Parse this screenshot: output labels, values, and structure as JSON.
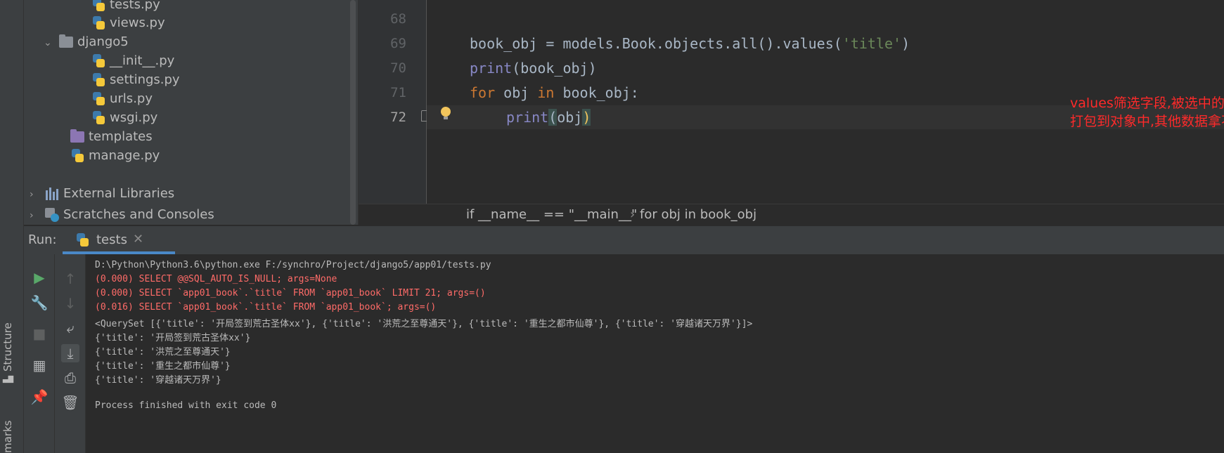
{
  "left_strip": {
    "structure": "Structure",
    "bookmarks": "marks"
  },
  "project_tree": {
    "items": [
      {
        "label": "tests.py",
        "type": "py"
      },
      {
        "label": "views.py",
        "type": "py"
      },
      {
        "label": "django5",
        "type": "folder",
        "expanded": true
      },
      {
        "label": "__init__.py",
        "type": "py"
      },
      {
        "label": "settings.py",
        "type": "py"
      },
      {
        "label": "urls.py",
        "type": "py"
      },
      {
        "label": "wsgi.py",
        "type": "py"
      },
      {
        "label": "templates",
        "type": "folder-template"
      },
      {
        "label": "manage.py",
        "type": "py"
      },
      {
        "label": "External Libraries",
        "type": "library",
        "collapsed": true
      },
      {
        "label": "Scratches and Consoles",
        "type": "scratch",
        "collapsed": true
      }
    ]
  },
  "editor": {
    "line_numbers": [
      "68",
      "69",
      "70",
      "71",
      "72"
    ],
    "lines": {
      "l69": {
        "a": "book_obj = models.Book.objects.all().values(",
        "s": "'title'",
        "b": ")"
      },
      "l70": {
        "fn": "print",
        "rest": "(book_obj)"
      },
      "l71": {
        "kw1": "for",
        "mid": " obj ",
        "kw2": "in",
        "rest": " book_obj:"
      },
      "l72": {
        "fn": "print",
        "open": "(",
        "arg": "obj",
        "close": ")"
      }
    },
    "annotation": {
      "line1": "values筛选字段,被选中的字段数据",
      "line2": "打包到对象中,其他数据拿不到了"
    }
  },
  "breadcrumbs": {
    "item1": "if __name__ == \"__main__\"",
    "sep": "›",
    "item2": "for obj in book_obj"
  },
  "run": {
    "label": "Run:",
    "tab": "tests",
    "close": "✕"
  },
  "console": {
    "lines": [
      {
        "text": "D:\\Python\\Python3.6\\python.exe F:/synchro/Project/django5/app01/tests.py",
        "style": "normal"
      },
      {
        "text": "(0.000) SELECT @@SQL_AUTO_IS_NULL; args=None",
        "style": "red"
      },
      {
        "text": "(0.000) SELECT `app01_book`.`title` FROM `app01_book` LIMIT 21; args=()",
        "style": "red"
      },
      {
        "text": "(0.016) SELECT `app01_book`.`title` FROM `app01_book`; args=()",
        "style": "red"
      },
      {
        "text": "<QuerySet [{'title': '开局签到荒古圣体xx'}, {'title': '洪荒之至尊通天'}, {'title': '重生之都市仙尊'}, {'title': '穿越诸天万界'}]>",
        "style": "normal"
      },
      {
        "text": "{'title': '开局签到荒古圣体xx'}",
        "style": "normal"
      },
      {
        "text": "{'title': '洪荒之至尊通天'}",
        "style": "normal"
      },
      {
        "text": "{'title': '重生之都市仙尊'}",
        "style": "normal"
      },
      {
        "text": "{'title': '穿越诸天万界'}",
        "style": "normal"
      },
      {
        "text": "",
        "style": "normal"
      },
      {
        "text": "Process finished with exit code 0",
        "style": "normal"
      }
    ]
  }
}
